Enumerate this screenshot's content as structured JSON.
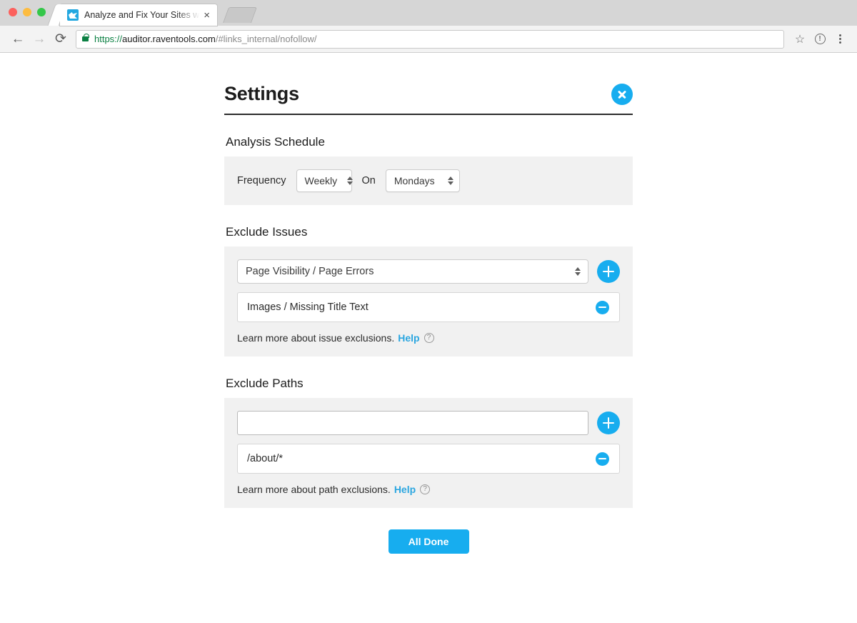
{
  "browser": {
    "tab": {
      "title": "Analyze and Fix Your Sites with",
      "close_label": "×",
      "favicon": "raven-logo-icon"
    },
    "nav": {
      "back_label": "←",
      "forward_label": "→",
      "reload_label": "⟳"
    },
    "omnibox": {
      "scheme": "https://",
      "host": "auditor.raventools.com",
      "path": "/#links_internal/nofollow/",
      "full_url": "https://auditor.raventools.com/#links_internal/nofollow/",
      "lock": "secure-lock-icon"
    },
    "actions": {
      "bookmark_label": "☆",
      "info_label": "!",
      "menu_label": "menu"
    }
  },
  "settings": {
    "title": "Settings",
    "close_tooltip": "Close",
    "accent_color": "#17adef",
    "panel_bg": "#f1f1f1",
    "schedule": {
      "section_label": "Analysis Schedule",
      "frequency_label": "Frequency",
      "frequency_value": "Weekly",
      "on_label": "On",
      "day_value": "Mondays"
    },
    "exclude_issues": {
      "section_label": "Exclude Issues",
      "select_value": "Page Visibility / Page Errors",
      "add_label": "+",
      "items": [
        {
          "label": "Images / Missing Title Text",
          "remove_label": "−"
        }
      ],
      "learn_more_text": "Learn more about issue exclusions.",
      "help_label": "Help",
      "help_icon_label": "?"
    },
    "exclude_paths": {
      "section_label": "Exclude Paths",
      "input_value": "",
      "input_placeholder": "",
      "add_label": "+",
      "items": [
        {
          "label": "/about/*",
          "remove_label": "−"
        }
      ],
      "learn_more_text": "Learn more about path exclusions.",
      "help_label": "Help",
      "help_icon_label": "?"
    },
    "done_button": "All Done"
  }
}
